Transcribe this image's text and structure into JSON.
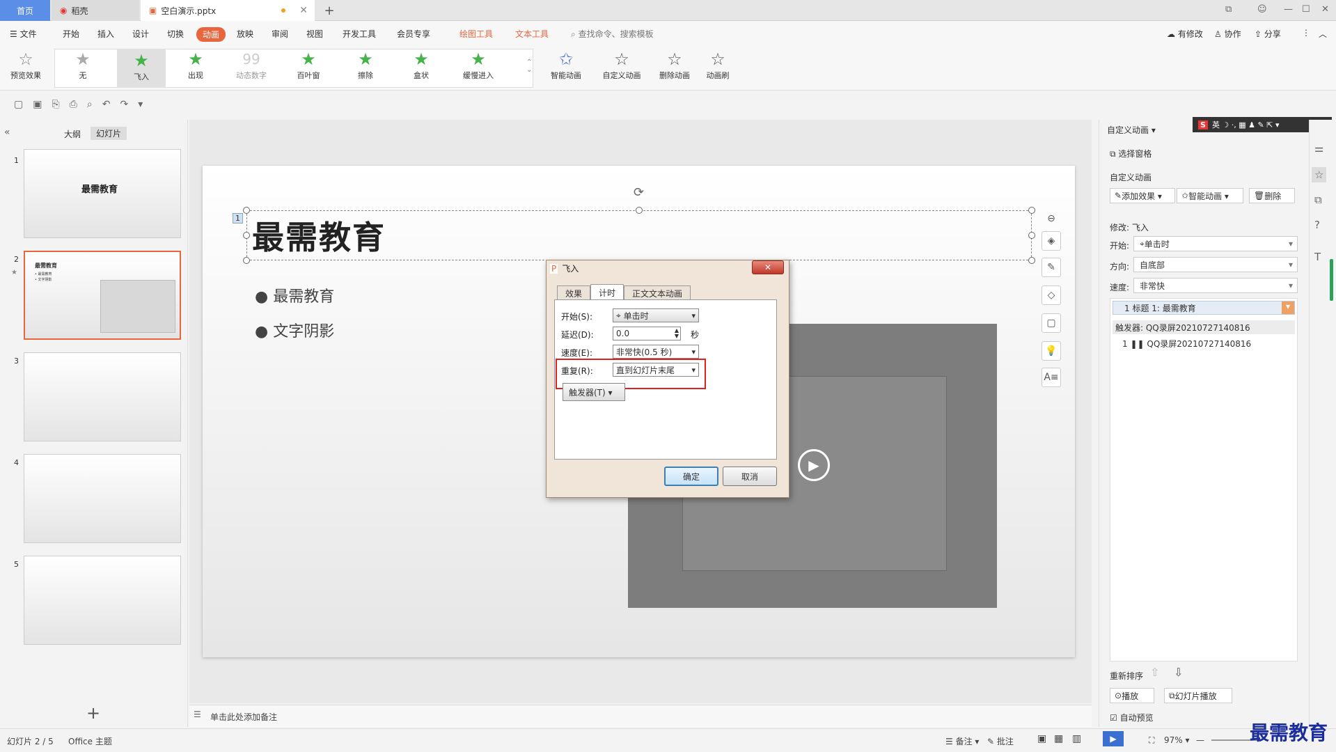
{
  "titlebar": {
    "home": "首页",
    "daoke": "稻壳",
    "file": "空白演示.pptx",
    "plus": "+",
    "restore": "⧉",
    "min": "—",
    "max": "☐",
    "close": "✕"
  },
  "menus": {
    "file": "☰ 文件",
    "start": "开始",
    "insert": "插入",
    "design": "设计",
    "switch": "切换",
    "animation": "动画",
    "slideshow": "放映",
    "review": "审阅",
    "view": "视图",
    "dev": "开发工具",
    "member": "会员专享",
    "draw": "绘图工具",
    "text": "文本工具",
    "search": "查找命令、搜索模板",
    "changes": "有修改",
    "collab": "协作",
    "share": "分享"
  },
  "ribbon": {
    "preview": "预览效果",
    "none": "无",
    "fly": "飞入",
    "appear": "出现",
    "dyn": "动态数字",
    "blinds": "百叶窗",
    "wipe": "擦除",
    "box": "盒状",
    "slow": "缓慢进入",
    "smart": "智能动画",
    "custom": "自定义动画",
    "delete": "删除动画",
    "brush": "动画刷",
    "dyn_icon": "99"
  },
  "leftpane": {
    "outline": "大纲",
    "slides": "幻灯片",
    "thumb1_title": "最需教育",
    "thumb2_title": "最需教育",
    "thumb2_b1": "• 最需教育",
    "thumb2_b2": "• 文字阴影",
    "add": "+"
  },
  "slide": {
    "title": "最需教育",
    "anim_marker": "1",
    "bullet1": "最需教育",
    "bullet2": "文字阴影",
    "play": "▶"
  },
  "notes": {
    "placeholder": "单击此处添加备注"
  },
  "dialog": {
    "title": "飞入",
    "tab_effect": "效果",
    "tab_timing": "计时",
    "tab_text": "正文文本动画",
    "start_label": "开始(S):",
    "start_value": "单击时",
    "delay_label": "延迟(D):",
    "delay_value": "0.0",
    "delay_unit": "秒",
    "speed_label": "速度(E):",
    "speed_value": "非常快(0.5 秒)",
    "repeat_label": "重复(R):",
    "repeat_value": "直到幻灯片末尾",
    "trigger": "触发器(T) ▾",
    "ok": "确定",
    "cancel": "取消",
    "close": "✕"
  },
  "rightpane": {
    "header": "自定义动画 ▾",
    "select_pane": "选择窗格",
    "custom_anim": "自定义动画",
    "add_effect": "添加效果 ▾",
    "smart_anim": "智能动画 ▾",
    "delete": "删除",
    "modify": "修改: 飞入",
    "start_label": "开始:",
    "start_value": "单击时",
    "direction_label": "方向:",
    "direction_value": "自底部",
    "speed_label": "速度:",
    "speed_value": "非常快",
    "item1": "1   标题 1: 最需教育",
    "trigger_header": "触发器: QQ录屏20210727140816",
    "item2": "1   ❚❚  QQ录屏20210727140816",
    "reorder": "重新排序",
    "play": "播放",
    "slideshow": "幻灯片播放",
    "autopreview": "自动预览"
  },
  "ime": {
    "s": "S",
    "rest": "英 ☽ ·, ▦ ♟ ✎ ⇱ ▾"
  },
  "status": {
    "slide": "幻灯片 2 / 5",
    "theme": "Office 主题",
    "notes": "备注 ▾",
    "comment": "批注",
    "zoom": "97% ▾",
    "minus": "—",
    "plus": "+"
  },
  "slide_nums": [
    "1",
    "2",
    "3",
    "4",
    "5"
  ],
  "watermark": "最需教育"
}
